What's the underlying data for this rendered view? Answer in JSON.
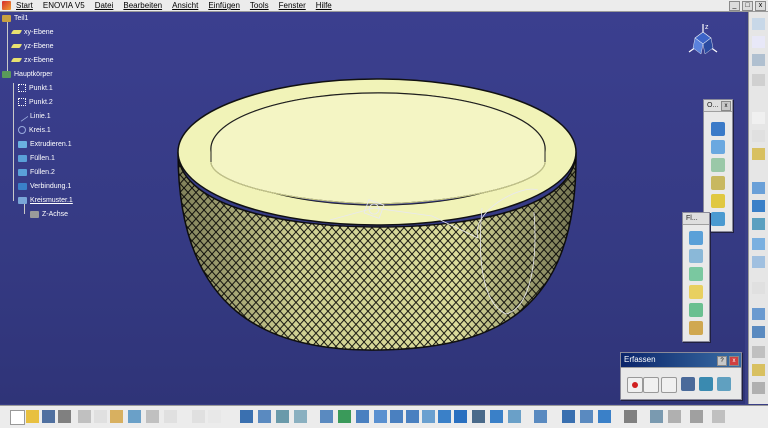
{
  "menubar": {
    "items": [
      "Start",
      "ENOVIA V5",
      "Datei",
      "Bearbeiten",
      "Ansicht",
      "Einfügen",
      "Tools",
      "Fenster",
      "Hilfe"
    ]
  },
  "window_controls": [
    "_",
    "□",
    "x"
  ],
  "tree": {
    "items": [
      {
        "label": "Teil1",
        "icon": "part-icon"
      },
      {
        "label": "xy-Ebene",
        "icon": "plane-icon"
      },
      {
        "label": "yz-Ebene",
        "icon": "plane-icon"
      },
      {
        "label": "zx-Ebene",
        "icon": "plane-icon"
      },
      {
        "label": "Hauptkörper",
        "icon": "body-icon"
      },
      {
        "label": "Punkt.1",
        "icon": "point-icon"
      },
      {
        "label": "Punkt.2",
        "icon": "point-icon"
      },
      {
        "label": "Linie.1",
        "icon": "line-icon"
      },
      {
        "label": "Kreis.1",
        "icon": "circle-icon"
      },
      {
        "label": "Extrudieren.1",
        "icon": "extrude-icon"
      },
      {
        "label": "Füllen.1",
        "icon": "fill-icon"
      },
      {
        "label": "Füllen.2",
        "icon": "fill-icon"
      },
      {
        "label": "Verbindung.1",
        "icon": "join-icon"
      },
      {
        "label": "Kreismuster.1",
        "icon": "circular-pattern-icon"
      },
      {
        "label": "Z-Achse",
        "icon": "axis-icon"
      }
    ]
  },
  "panels": {
    "panel_o": {
      "title": "O..."
    },
    "panel_fl": {
      "title": "Fl..."
    },
    "erfassen": {
      "title": "Erfassen",
      "help": "?",
      "close": "x"
    }
  },
  "compass": {
    "label": "z"
  },
  "colors": {
    "viewport_bg": "#3a3f86",
    "ring_face": "#f1f3b8",
    "ring_mesh": "#1a1a12",
    "toolbar_bg": "#ececec"
  }
}
